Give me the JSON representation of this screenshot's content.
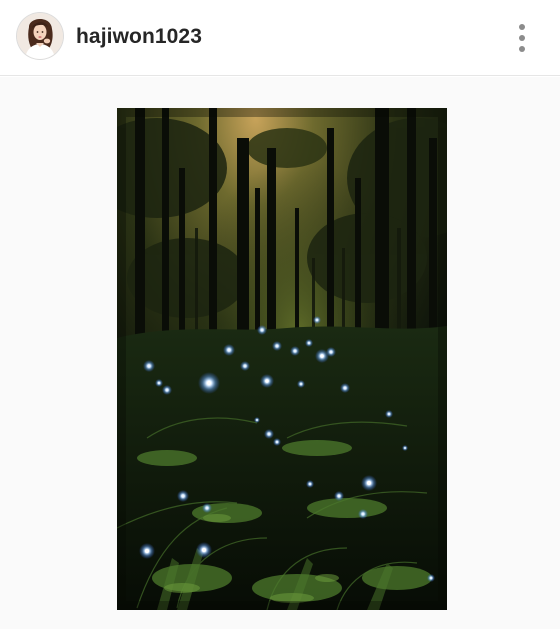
{
  "post": {
    "username": "hajiwon1023",
    "avatar_icon": "profile-photo-avatar",
    "more_icon": "more-vertical-icon",
    "photo_icon": "forest-fireflies-photo"
  },
  "colors": {
    "username_text": "#262626",
    "divider": "#e6e6e6",
    "more_dots": "#8c8c8c",
    "media_background": "#fafafa"
  }
}
